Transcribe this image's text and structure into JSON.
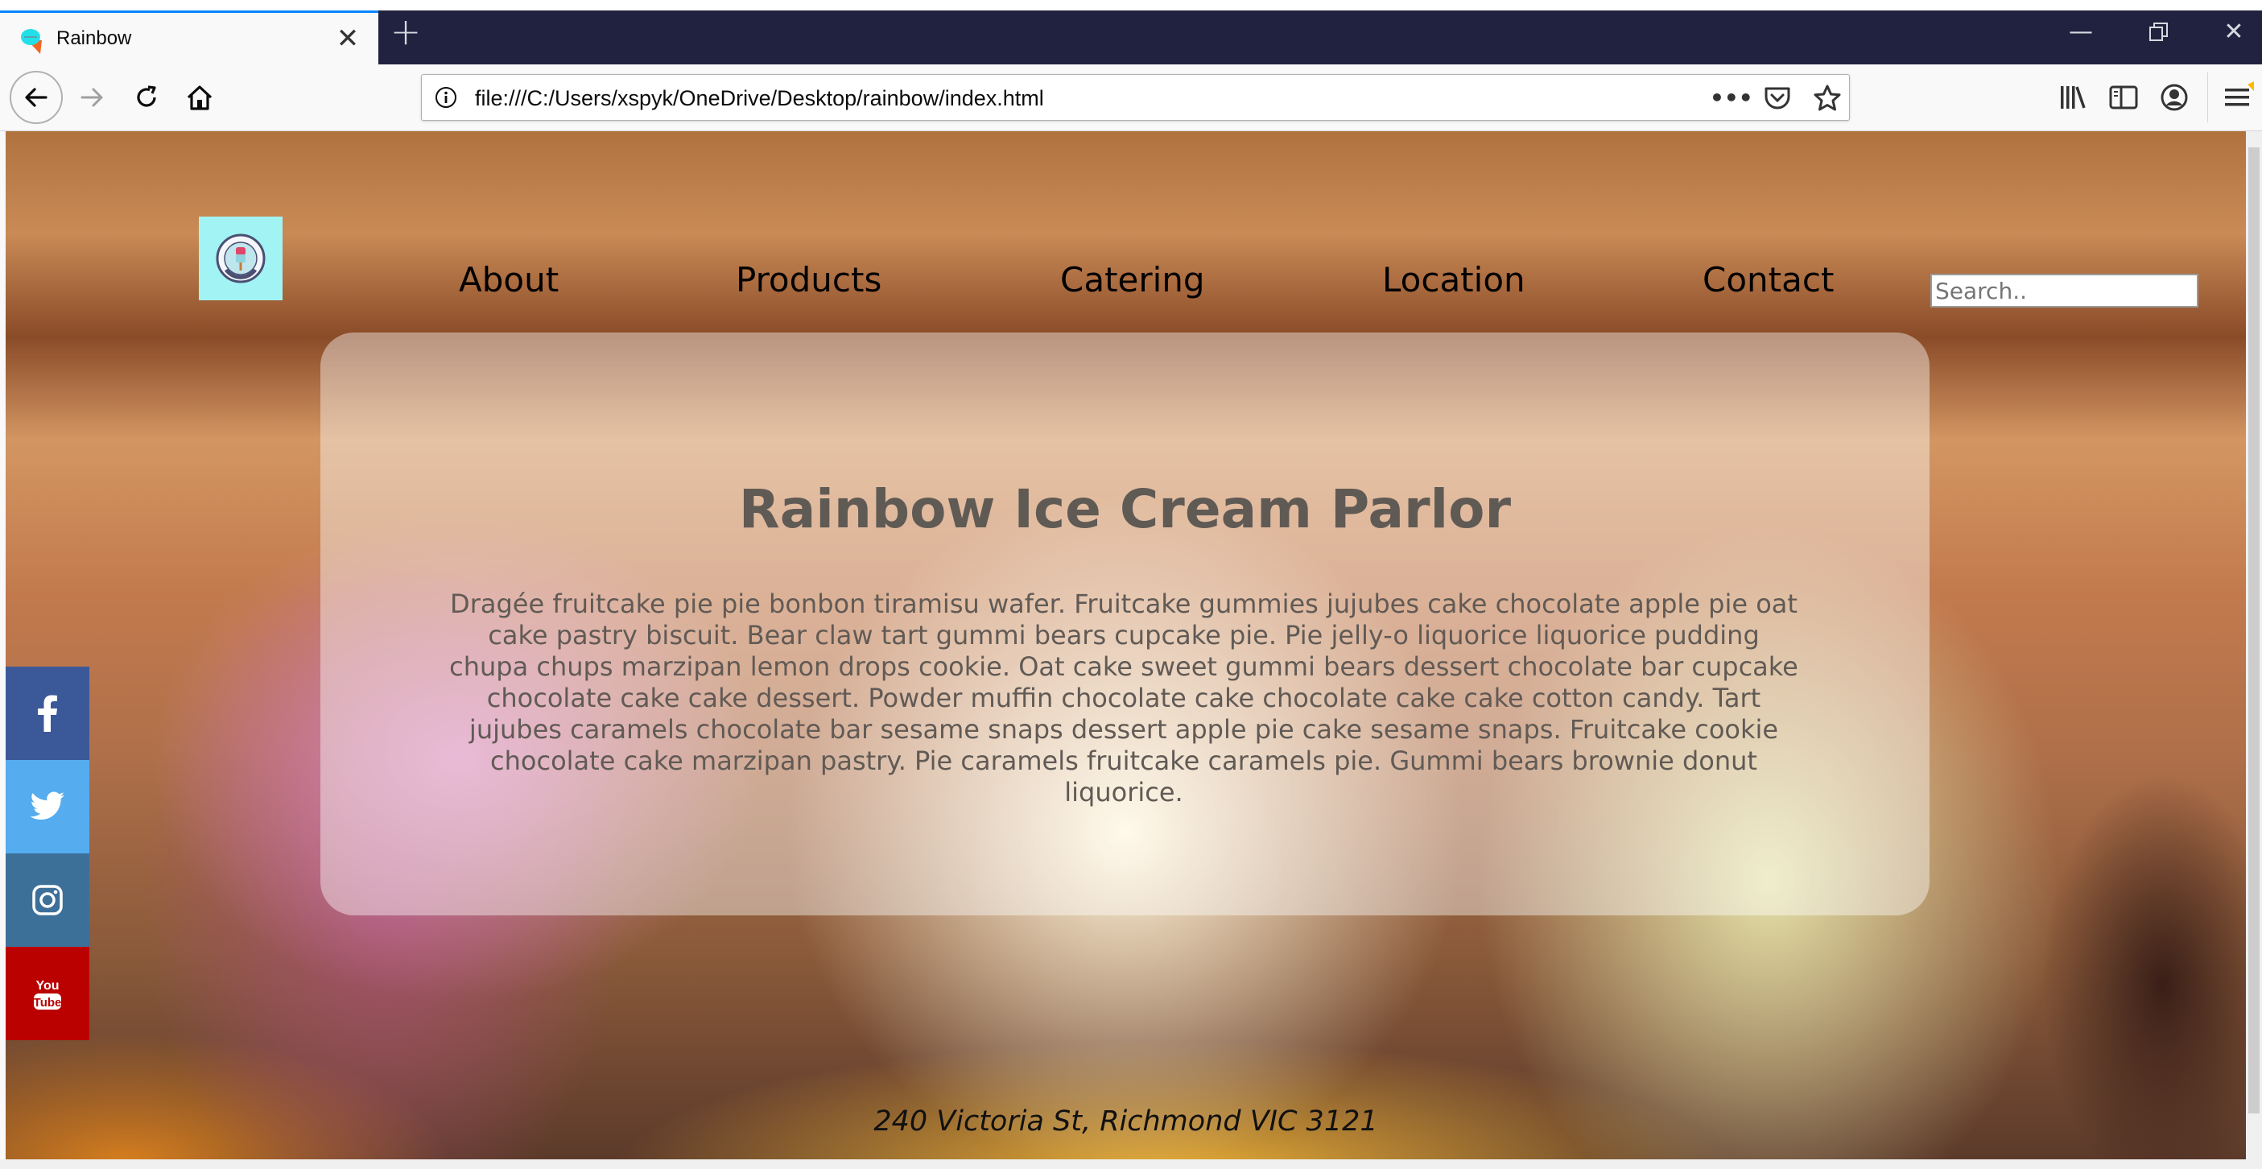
{
  "browser": {
    "tab_title": "Rainbow",
    "new_tab_label": "+",
    "url": "file:///C:/Users/xspyk/OneDrive/Desktop/rainbow/index.html",
    "window_controls": {
      "minimize": "—",
      "restore": "❐",
      "close": "✕"
    },
    "tab_close": "✕",
    "page_actions": "•••"
  },
  "page": {
    "nav": {
      "items": [
        {
          "label": "About"
        },
        {
          "label": "Products"
        },
        {
          "label": "Catering"
        },
        {
          "label": "Location"
        },
        {
          "label": "Contact"
        }
      ],
      "search_placeholder": "Search.."
    },
    "hero": {
      "title": "Rainbow Ice Cream Parlor",
      "body": "Dragée fruitcake pie pie bonbon tiramisu wafer. Fruitcake gummies jujubes cake chocolate apple pie oat cake pastry biscuit. Bear claw tart gummi bears cupcake pie. Pie jelly-o liquorice liquorice pudding chupa chups marzipan lemon drops cookie. Oat cake sweet gummi bears dessert chocolate bar cupcake chocolate cake cake dessert. Powder muffin chocolate cake chocolate cake cake cotton candy. Tart jujubes caramels chocolate bar sesame snaps dessert apple pie cake sesame snaps. Fruitcake cookie chocolate cake marzipan pastry. Pie caramels fruitcake caramels pie. Gummi bears brownie donut liquorice."
    },
    "social": [
      {
        "name": "facebook",
        "icon": "facebook-icon",
        "color": "#3b5998"
      },
      {
        "name": "twitter",
        "icon": "twitter-icon",
        "color": "#55acee"
      },
      {
        "name": "instagram",
        "icon": "instagram-icon",
        "color": "#3d7099"
      },
      {
        "name": "youtube",
        "icon": "youtube-icon",
        "color": "#bb0000"
      }
    ],
    "footer_address": "240 Victoria St, Richmond VIC 3121",
    "colors": {
      "logo_bg": "#a2f3f3",
      "tabstrip_bg": "#20223f",
      "tab_accent": "#0a84ff"
    }
  }
}
